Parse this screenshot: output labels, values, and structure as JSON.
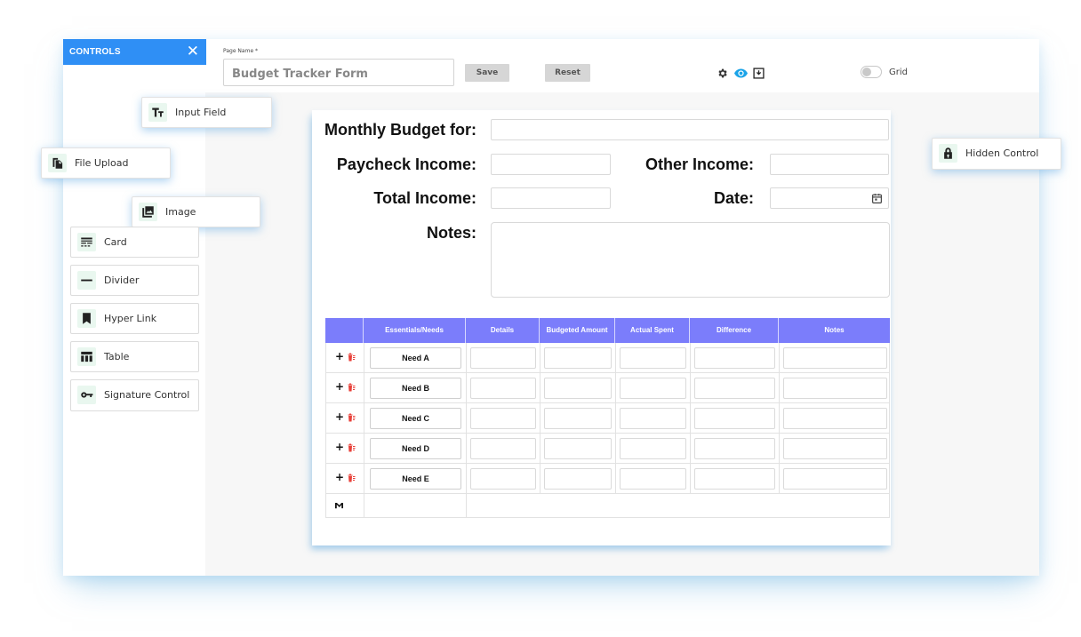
{
  "sidebar": {
    "title": "CONTROLS",
    "close_icon": "close-icon",
    "controls": [
      {
        "label": "Input Field",
        "icon": "text-size-icon",
        "floating": true
      },
      {
        "label": "File Upload",
        "icon": "file-copy-icon",
        "floating": true
      },
      {
        "label": "Image",
        "icon": "image-icon",
        "floating": true
      },
      {
        "label": "Card",
        "icon": "card-icon",
        "floating": false
      },
      {
        "label": "Divider",
        "icon": "divider-icon",
        "floating": false
      },
      {
        "label": "Hyper Link",
        "icon": "bookmark-icon",
        "floating": false
      },
      {
        "label": "Table",
        "icon": "table-icon",
        "floating": false
      },
      {
        "label": "Signature Control",
        "icon": "key-icon",
        "floating": false
      },
      {
        "label": "Hidden Control",
        "icon": "lock-icon",
        "floating": true
      }
    ]
  },
  "toolbar": {
    "page_name_label": "Page Name *",
    "page_name_value": "Budget Tracker Form",
    "save_label": "Save",
    "reset_label": "Reset",
    "icons": [
      "gear-icon",
      "eye-icon",
      "download-icon"
    ],
    "grid_label": "Grid",
    "grid_on": false
  },
  "form": {
    "labels": {
      "monthly": "Monthly Budget for:",
      "paycheck": "Paycheck Income:",
      "other": "Other Income:",
      "total": "Total Income:",
      "date": "Date:",
      "notes": "Notes:"
    },
    "table": {
      "headers": [
        "Essentials/Needs",
        "Details",
        "Budgeted Amount",
        "Actual Spent",
        "Difference",
        "Notes"
      ],
      "rows": [
        "Need A",
        "Need B",
        "Need C",
        "Need D",
        "Need E"
      ],
      "sum_symbol": "Σ"
    }
  },
  "colors": {
    "header_blue": "#2f8ff5",
    "table_header": "#7b7dfb",
    "icon_bg": "#e9f7ef",
    "eye_blue": "#1aa3e8",
    "trash_red": "#e8413a"
  }
}
